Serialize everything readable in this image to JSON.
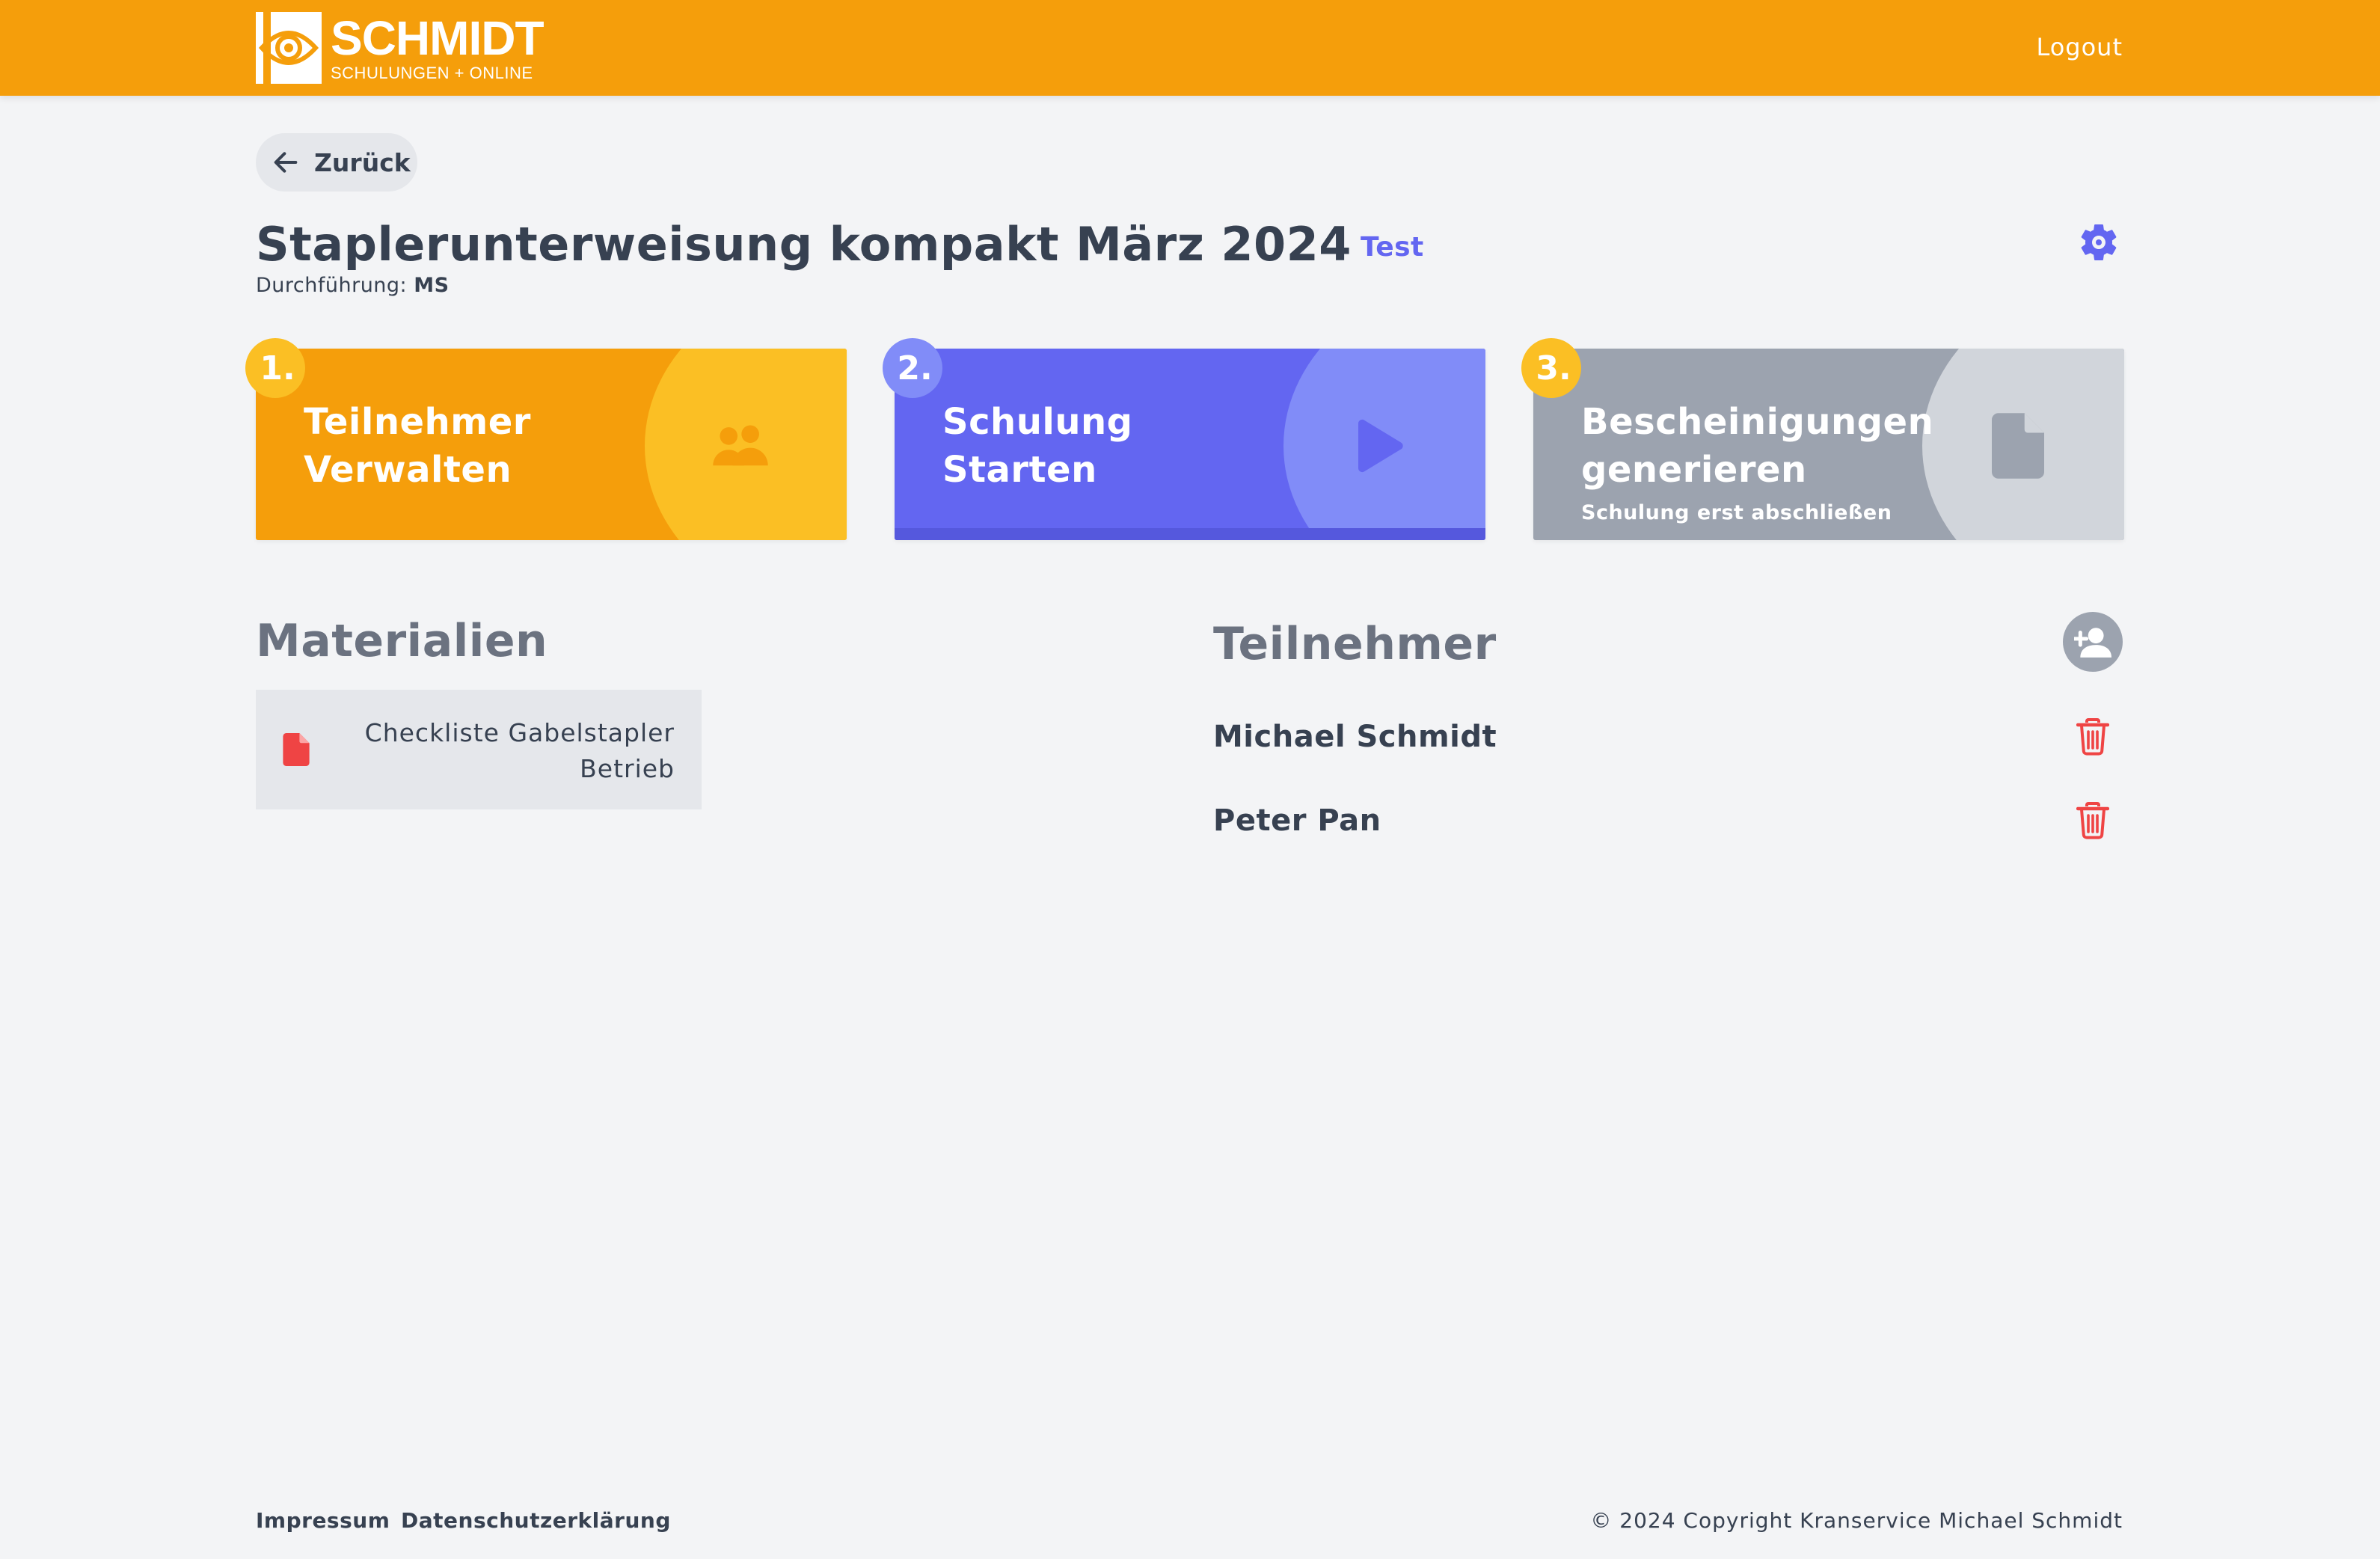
{
  "header": {
    "logo_name": "SCHMIDT",
    "logo_subtitle": "SCHULUNGEN + ONLINE",
    "logout_label": "Logout"
  },
  "back_label": "Zurück",
  "training": {
    "title": "Staplerunterweisung kompakt März 2024",
    "tag": "Test",
    "performer_label": "Durchführung:",
    "performer_value": "MS"
  },
  "steps": [
    {
      "number": "1.",
      "line1": "Teilnehmer",
      "line2": "Verwalten",
      "hint": "",
      "icon": "users-icon",
      "color": "#f59e0b"
    },
    {
      "number": "2.",
      "line1": "Schulung",
      "line2": "Starten",
      "hint": "",
      "icon": "play-icon",
      "color": "#6366f1"
    },
    {
      "number": "3.",
      "line1": "Bescheinigungen",
      "line2": "generieren",
      "hint": "Schulung erst abschließen",
      "icon": "document-icon",
      "color": "#9ca3af"
    }
  ],
  "materials": {
    "heading": "Materialien",
    "items": [
      {
        "name": "Checkliste Gabelstapler Betrieb",
        "icon": "file-icon"
      }
    ]
  },
  "participants": {
    "heading": "Teilnehmer",
    "items": [
      {
        "name": "Michael Schmidt"
      },
      {
        "name": "Peter Pan"
      }
    ]
  },
  "footer": {
    "impressum": "Impressum",
    "privacy": "Datenschutzerklärung",
    "copyright": "© 2024 Copyright Kranservice Michael Schmidt"
  },
  "colors": {
    "header": "#f59e0b",
    "accent": "#6366f1",
    "danger": "#ef4444",
    "background": "#f3f4f6"
  }
}
